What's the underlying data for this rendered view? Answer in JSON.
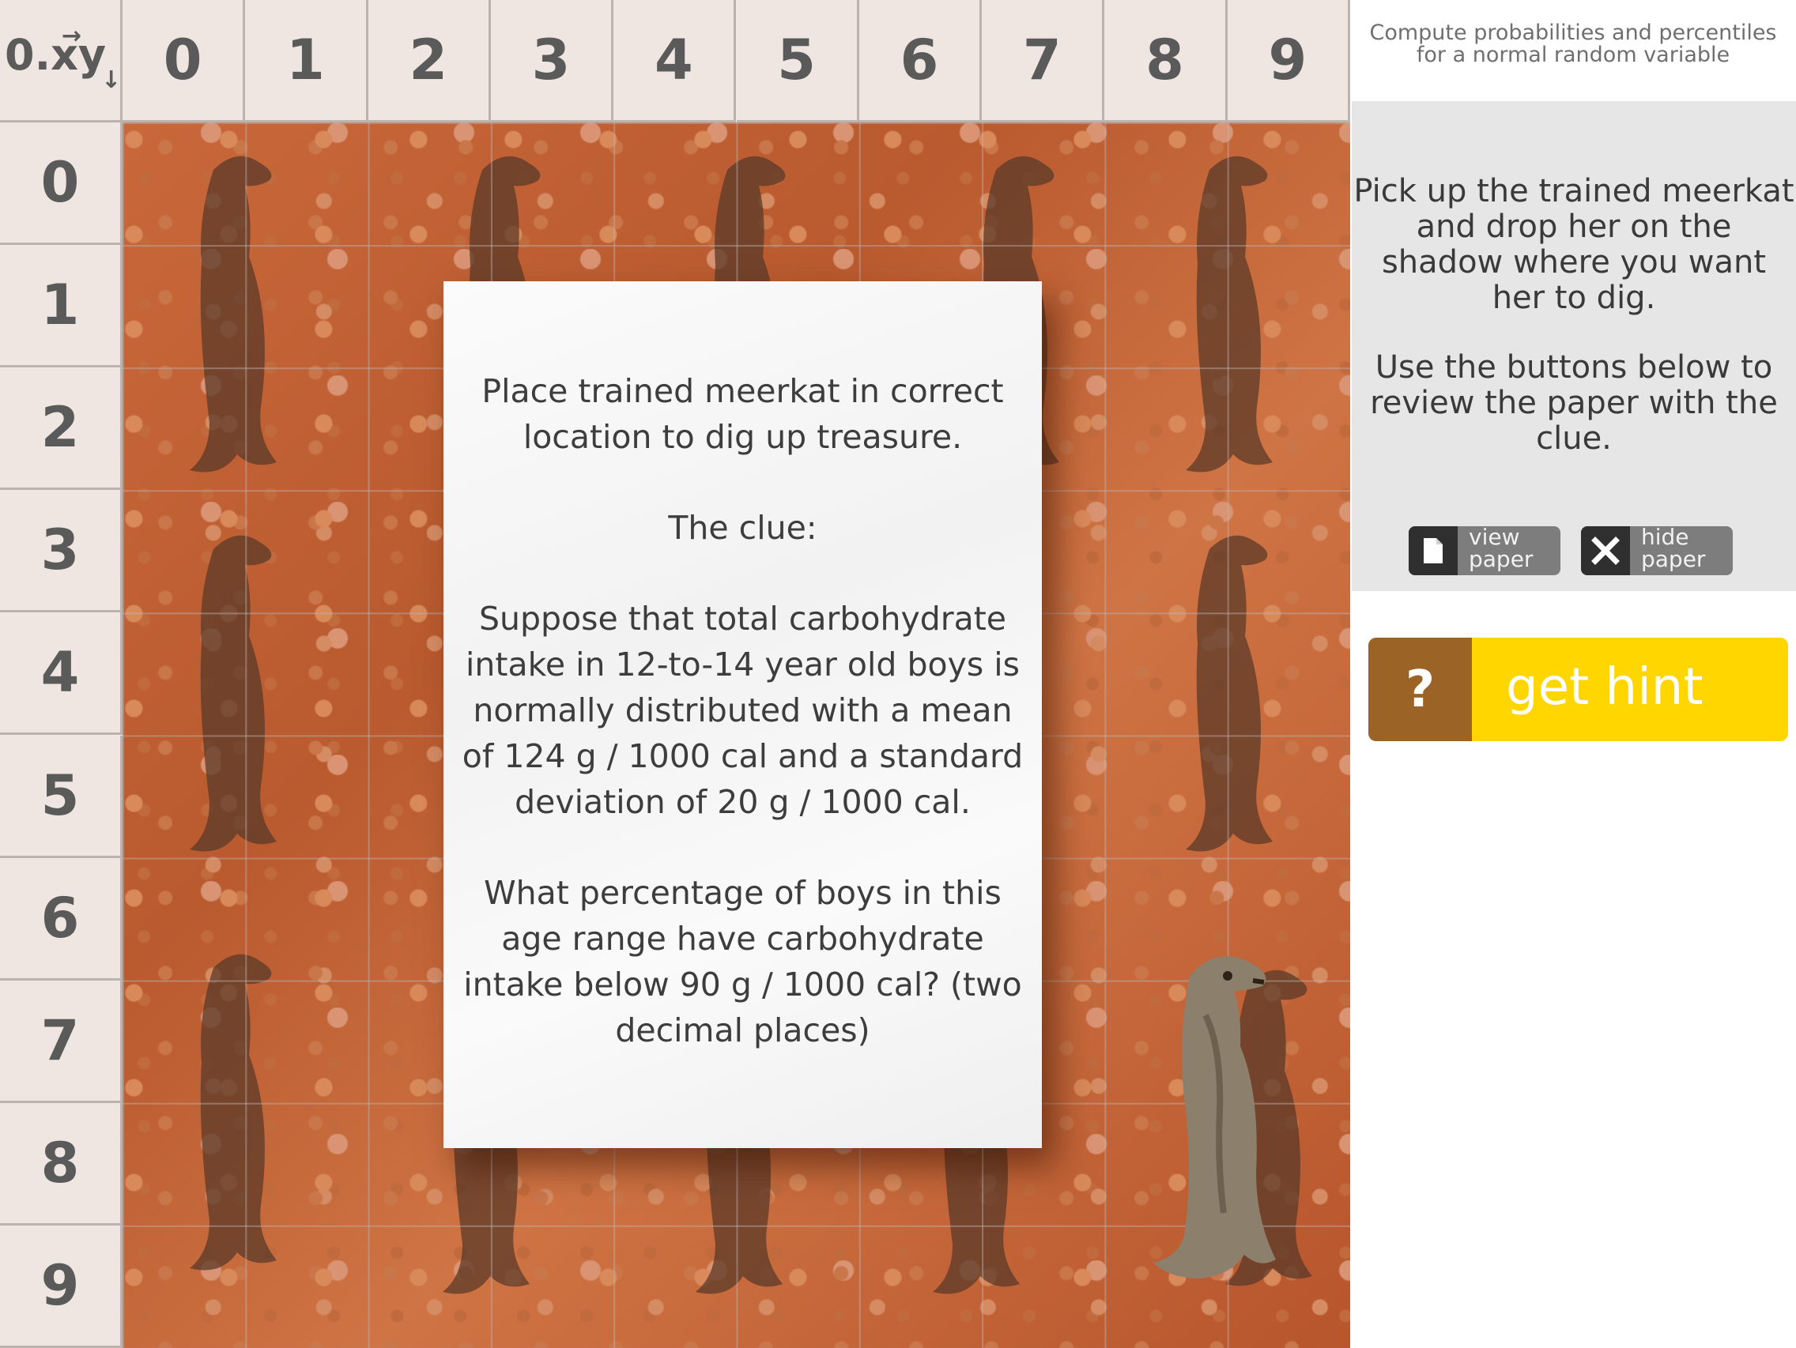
{
  "board": {
    "corner_label": "0.xy",
    "corner_arrow_x": "→",
    "corner_arrow_y": "↓",
    "col_labels": [
      "0",
      "1",
      "2",
      "3",
      "4",
      "5",
      "6",
      "7",
      "8",
      "9"
    ],
    "row_labels": [
      "0",
      "1",
      "2",
      "3",
      "4",
      "5",
      "6",
      "7",
      "8",
      "9"
    ]
  },
  "paper": {
    "intro": "Place trained meerkat in correct location to dig up treasure.",
    "clue_heading": "The clue:",
    "clue_body": "Suppose that total carbohydrate intake in 12-to-14 year old boys is normally distributed with a mean of 124 g / 1000 cal and a standard deviation of 20 g / 1000 cal.",
    "question": "What percentage of boys in this age range have carbohydrate intake below 90 g / 1000 cal? (two decimal places)"
  },
  "sidebar": {
    "subtitle": "Compute probabilities and percentiles for a normal random variable",
    "instruction_1": "Pick up the trained meerkat and drop her on the shadow where you want her to dig.",
    "instruction_2": "Use the buttons below to review the paper with the clue.",
    "view_paper_label": "view paper",
    "hide_paper_label": "hide paper",
    "hint_icon": "?",
    "hint_label": "get hint"
  },
  "colors": {
    "hint_yellow": "#ffd600",
    "hint_brown": "#9b6426",
    "ground": "#c8683a"
  }
}
